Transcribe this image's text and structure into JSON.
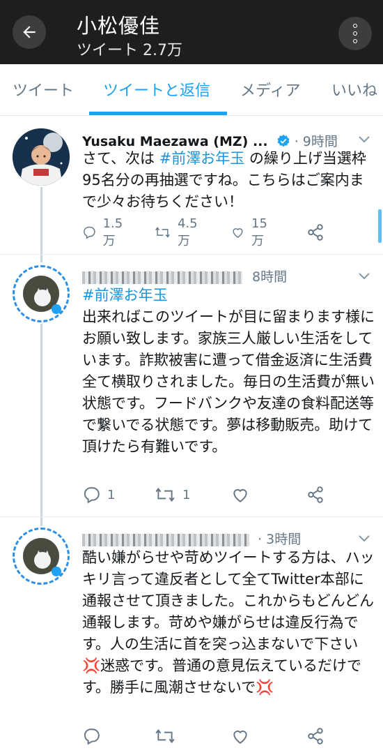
{
  "header": {
    "title": "小松優佳",
    "subtitle": "ツイート 2.7万"
  },
  "tabs": [
    {
      "label": "ツイート"
    },
    {
      "label": "ツイートと返信"
    },
    {
      "label": "メディア"
    },
    {
      "label": "いいね"
    }
  ],
  "tweets": [
    {
      "name": "Yusaku Maezawa (MZ) ...",
      "time": "· 9時間",
      "text_pre": "さて、次は ",
      "hashtag": "#前澤お年玉",
      "text_post": " の繰り上げ当選枠95名分の再抽選ですね。こちらはご案内まで少々お待ちください！",
      "replies": "1.5万",
      "retweets": "4.5万",
      "likes": "15万"
    },
    {
      "time": "8時間",
      "hashtag": "#前澤お年玉",
      "text": "出来ればこのツイートが目に留まります様にお願い致します。家族三人厳しい生活をしています。詐欺被害に遭って借金返済に生活費全て横取りされました。毎日の生活費が無い状態です。フードバンクや友達の食料配送等で繋いでる状態です。夢は移動販売。助けて頂けたら有難いです。",
      "replies": "1",
      "retweets": "1"
    },
    {
      "time": "· 3時間",
      "text": "酷い嫌がらせや苛めツイートする方は、ハッキリ言って違反者として全てTwitter本部に通報させて頂きました。これからもどんどん通報します。苛めや嫌がらせは違反行為です。人の生活に首を突っ込まないで下さい💢迷惑です。普通の意見伝えているだけです。勝手に風潮させないで💢"
    }
  ],
  "colors": {
    "accent": "#1da1f2",
    "header_bg": "#1c1f1d",
    "muted": "#657786"
  },
  "icons": [
    "back-arrow-icon",
    "more-vertical-icon",
    "verified-icon",
    "chevron-down-icon",
    "reply-icon",
    "retweet-icon",
    "like-icon",
    "share-icon"
  ]
}
